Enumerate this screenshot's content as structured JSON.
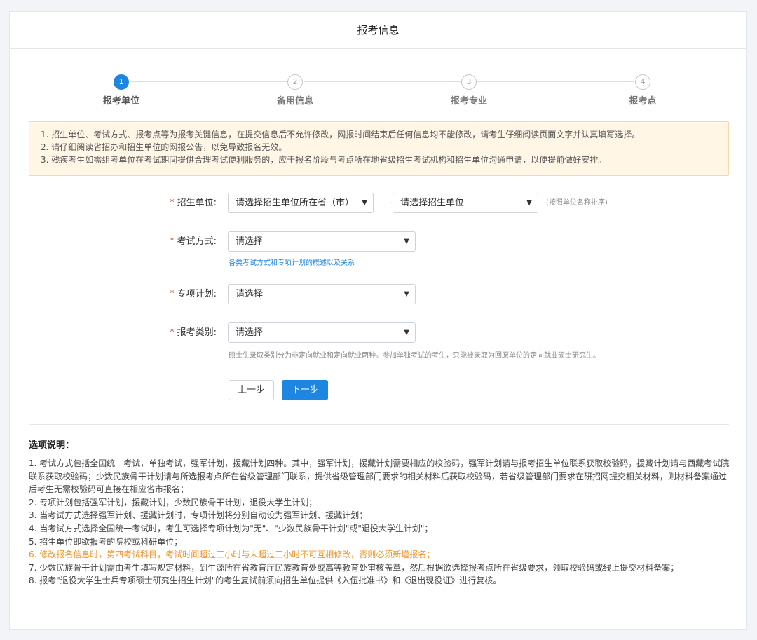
{
  "header": {
    "title": "报考信息"
  },
  "steps": [
    {
      "num": "1",
      "label": "报考单位",
      "active": true
    },
    {
      "num": "2",
      "label": "备用信息",
      "active": false
    },
    {
      "num": "3",
      "label": "报考专业",
      "active": false
    },
    {
      "num": "4",
      "label": "报考点",
      "active": false
    }
  ],
  "notice": [
    "1. 招生单位、考试方式、报考点等为报考关键信息，在提交信息后不允许修改，网报时间结束后任何信息均不能修改，请考生仔细阅读页面文字并认真填写选择。",
    "2. 请仔细阅读省招办和招生单位的网报公告，以免导致报名无效。",
    "3. 残疾考生如需组考单位在考试期间提供合理考试便利服务的，应于报名阶段与考点所在地省级招生考试机构和招生单位沟通申请，以便提前做好安排。"
  ],
  "form": {
    "required_mark": "*",
    "unit": {
      "label": "招生单位:",
      "province_value": "请选择招生单位所在省（市）",
      "separator": "-",
      "unit_value": "请选择招生单位",
      "hint": "(按照单位名称排序)"
    },
    "exam_mode": {
      "label": "考试方式:",
      "value": "请选择",
      "link": "各类考试方式和专项计划的概述以及关系"
    },
    "special_plan": {
      "label": "专项计划:",
      "value": "请选择"
    },
    "category": {
      "label": "报考类别:",
      "value": "请选择",
      "note": "硕士生录取类别分为非定向就业和定向就业两种。参加单独考试的考生，只能被录取为回原单位的定向就业硕士研究生。"
    },
    "prev_button": "上一步",
    "next_button": "下一步"
  },
  "explain": {
    "title": "选项说明：",
    "lines": [
      "1. 考试方式包括全国统一考试，单独考试，强军计划，援藏计划四种。其中，强军计划，援藏计划需要相应的校验码，强军计划请与报考招生单位联系获取校验码，援藏计划请与西藏考试院联系获取校验码；少数民族骨干计划请与所选报考点所在省级管理部门联系，提供省级管理部门要求的相关材料后获取校验码，若省级管理部门要求在研招网提交相关材料，则材料备案通过后考生无需校验码可直接在相应省市报名；",
      "2. 专项计划包括强军计划，援藏计划，少数民族骨干计划，退役大学生计划；",
      "3. 当考试方式选择强军计划、援藏计划时，专项计划将分别自动设为强军计划、援藏计划；",
      "4. 当考试方式选择全国统一考试时，考生可选择专项计划为\"无\"、\"少数民族骨干计划\"或\"退役大学生计划\"；",
      "5. 招生单位即欲报考的院校或科研单位；",
      "6. 修改报名信息时，第四考试科目，考试时间超过三小时与未超过三小时不可互相修改，否则必须新增报名；",
      "7. 少数民族骨干计划需由考生填写规定材料，到生源所在省教育厅民族教育处或高等教育处审核盖章，然后根据欲选择报考点所在省级要求，领取校验码或线上提交材料备案；",
      "8. 报考\"退役大学生士兵专项硕士研究生招生计划\"的考生复试前须向招生单位提供《入伍批准书》和《退出现役证》进行复核。"
    ]
  },
  "colors": {
    "primary": "#1d86e0",
    "warning_text": "#f0942b",
    "required": "#e0463d",
    "notice_bg": "#fff6e6"
  },
  "icons": {
    "select_arrow": "chevron-down-icon"
  }
}
